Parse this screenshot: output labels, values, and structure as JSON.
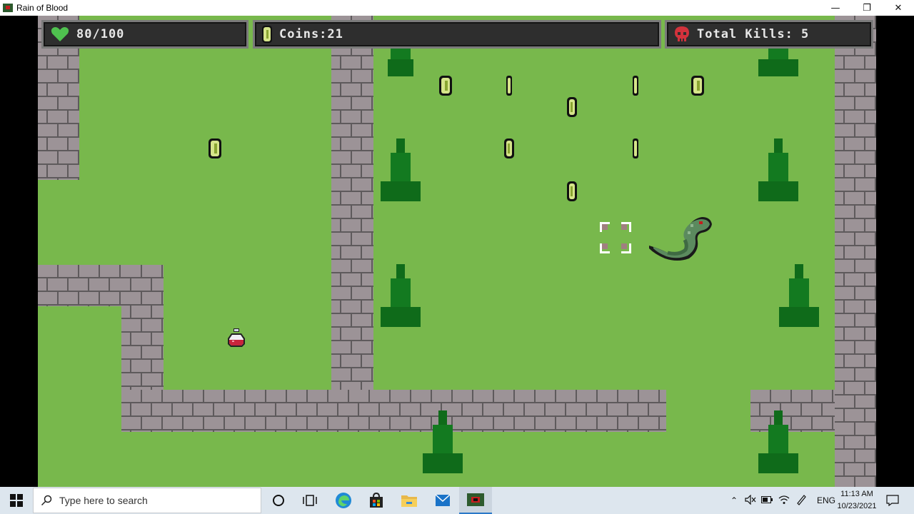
{
  "window": {
    "title": "Rain of Blood",
    "minimize": "—",
    "maximize": "❐",
    "close": "✕"
  },
  "hud": {
    "health": "80/100",
    "health_level": 0.8,
    "coins": "Coins:21",
    "kills": "Total Kills: 5"
  },
  "colors": {
    "grass": "#78b84c",
    "brick": "#9c9397",
    "tree": "#0f6b1a",
    "hud_bg": "#2e2e2e"
  },
  "taskbar": {
    "search_placeholder": "Type here to search",
    "language": "ENG",
    "time": "11:13 AM",
    "date": "10/23/2021",
    "apps": [
      "cortana-icon",
      "task-view-icon",
      "edge-icon",
      "store-icon",
      "file-explorer-icon",
      "mail-icon",
      "rain-of-blood-icon"
    ]
  }
}
